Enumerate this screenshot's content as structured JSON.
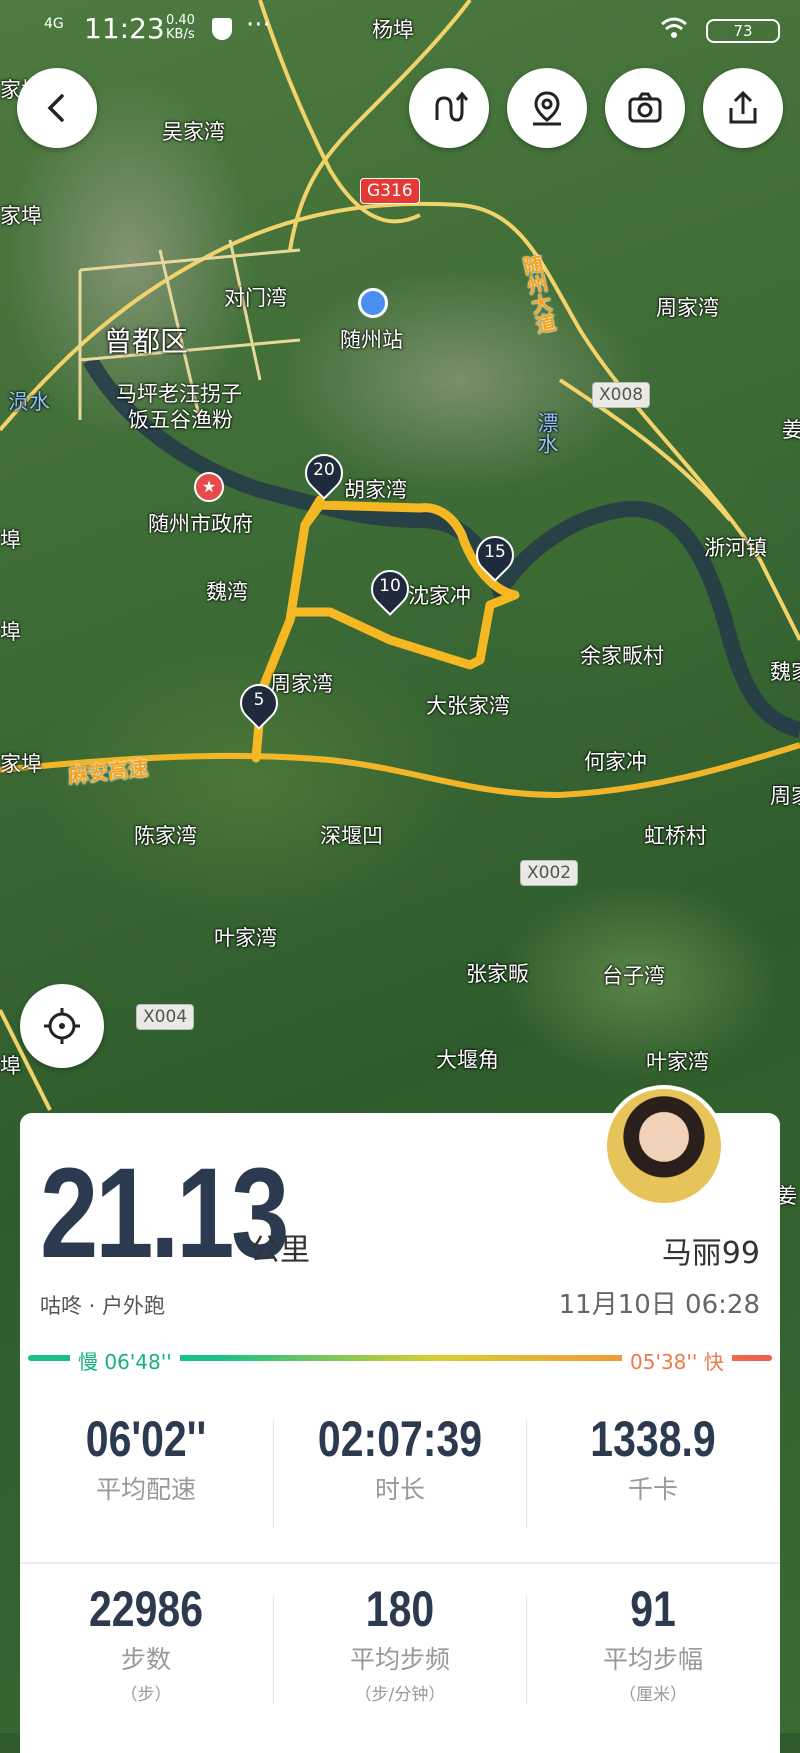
{
  "status_bar": {
    "signal": "4G",
    "time": "11:23",
    "speed_value": "0.40",
    "speed_unit": "KB/s",
    "dots": "···",
    "battery": "73"
  },
  "map": {
    "places": [
      "杨埠",
      "吴家湾",
      "家埠",
      "家埠",
      "对门湾",
      "随州站",
      "周家湾",
      "曾都区",
      "涢水",
      "马坪老汪拐子",
      "饭五谷渔粉",
      "随州市政府",
      "胡家湾",
      "沈家冲",
      "浙河镇",
      "魏湾",
      "余家畈村",
      "周家湾",
      "大张家湾",
      "何家冲",
      "陈家湾",
      "深堰凹",
      "虹桥村",
      "叶家湾",
      "张家畈",
      "台子湾",
      "大堰角",
      "叶家湾",
      "家埠",
      "埠",
      "埠",
      "埠",
      "魏家",
      "周家",
      "姜",
      "姜"
    ],
    "river_label": "漂水",
    "road_labels": [
      "随州大道",
      "麻安高速"
    ],
    "road_tags": [
      "G316",
      "X008",
      "X002",
      "X004"
    ],
    "km_markers": [
      "20",
      "15",
      "10",
      "5"
    ],
    "accent_route": "#f5b823"
  },
  "buttons": {
    "back": "back-icon",
    "route": "route-icon",
    "location": "location-pin-icon",
    "camera": "camera-icon",
    "share": "share-icon",
    "locate": "crosshair-icon"
  },
  "summary": {
    "distance": "21.13",
    "unit": "公里",
    "user_name": "马丽99",
    "source": "咕咚 · 户外跑",
    "datetime": "11月10日 06:28",
    "slow_label": "慢 06'48''",
    "fast_label": "05'38'' 快"
  },
  "stats": [
    {
      "value": "06'02''",
      "label": "平均配速",
      "sub": ""
    },
    {
      "value": "02:07:39",
      "label": "时长",
      "sub": ""
    },
    {
      "value": "1338.9",
      "label": "千卡",
      "sub": ""
    },
    {
      "value": "22986",
      "label": "步数",
      "sub": "（步）"
    },
    {
      "value": "180",
      "label": "平均步频",
      "sub": "（步/分钟）"
    },
    {
      "value": "91",
      "label": "平均步幅",
      "sub": "（厘米）"
    }
  ]
}
